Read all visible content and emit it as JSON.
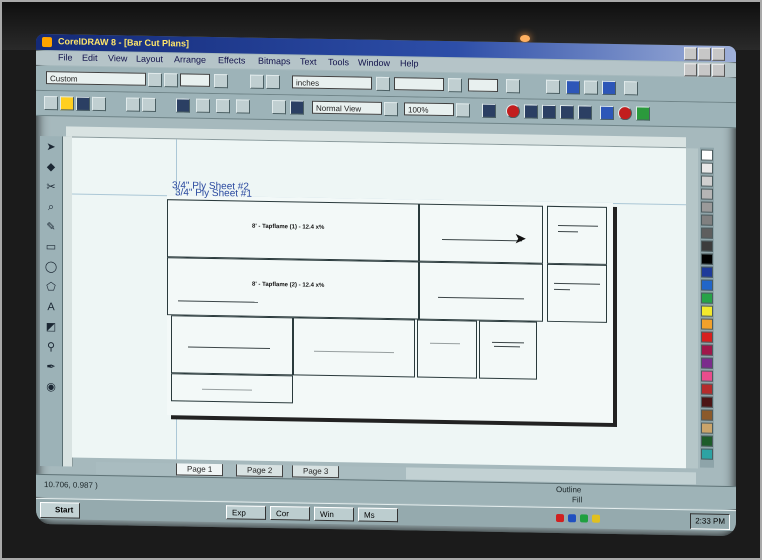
{
  "window": {
    "title": "CorelDRAW 8 - [Bar Cut Plans]"
  },
  "menu": [
    "File",
    "Edit",
    "View",
    "Layout",
    "Arrange",
    "Effects",
    "Bitmaps",
    "Text",
    "Tools",
    "Window",
    "Help"
  ],
  "toolbar": {
    "font_field": "Custom",
    "unit_field": "inches",
    "zoom_field": "Normal View",
    "zoom_percent": "100%"
  },
  "document": {
    "sheet_labels": [
      "3/4\" Ply Sheet #2",
      "3/4\" Ply Sheet #1"
    ],
    "part_labels": [
      "8' - Tapflame (1) - 12.4 x%",
      "8' - Tapflame (2) - 12.4 x%"
    ]
  },
  "page_tabs": [
    "Page 1",
    "Page 2",
    "Page 3"
  ],
  "status": {
    "left": "10.706, 0.987 )",
    "right": "Outline",
    "right2": "Fill"
  },
  "taskbar": {
    "start_label": "Start",
    "tasks": [
      "Exp",
      "Cor",
      "Win",
      "Ms"
    ],
    "clock": "2:33 PM"
  },
  "colors": {
    "title_bar": "#1d3a8c",
    "palette": [
      "#ffffff",
      "#e8e8e8",
      "#cfcfcf",
      "#b5b5b5",
      "#9a9a9a",
      "#808080",
      "#5e5e5e",
      "#3c3c3c",
      "#000000",
      "#1e3a9a",
      "#2166c8",
      "#27a348",
      "#f2e92c",
      "#f2a12a",
      "#d71f1f",
      "#a0174a",
      "#7b2c8c",
      "#e94c8c",
      "#b52c2c",
      "#4c1515",
      "#8b5a2b",
      "#caa46a",
      "#1d5c2a",
      "#2da3a3"
    ]
  }
}
